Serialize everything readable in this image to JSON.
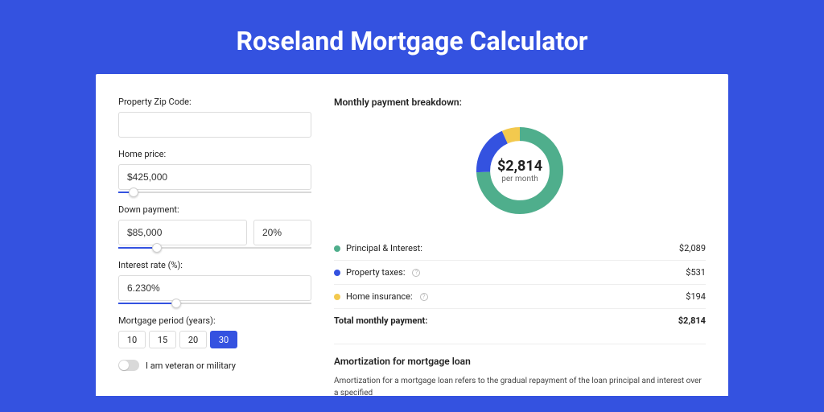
{
  "header": {
    "title": "Roseland Mortgage Calculator"
  },
  "form": {
    "zip_label": "Property Zip Code:",
    "zip_value": "",
    "home_price_label": "Home price:",
    "home_price_value": "$425,000",
    "home_price_slider_pct": 8,
    "down_payment_label": "Down payment:",
    "down_payment_value": "$85,000",
    "down_payment_pct_value": "20%",
    "down_payment_slider_pct": 20,
    "interest_label": "Interest rate (%):",
    "interest_value": "6.230%",
    "interest_slider_pct": 30,
    "period_label": "Mortgage period (years):",
    "period_options": [
      "10",
      "15",
      "20",
      "30"
    ],
    "period_active": "30",
    "veteran_label": "I am veteran or military"
  },
  "breakdown": {
    "title": "Monthly payment breakdown:",
    "center_amount": "$2,814",
    "center_sub": "per month",
    "items": [
      {
        "label": "Principal & Interest:",
        "value": "$2,089",
        "color": "#4fae8c",
        "help": false
      },
      {
        "label": "Property taxes:",
        "value": "$531",
        "color": "#3452e0",
        "help": true
      },
      {
        "label": "Home insurance:",
        "value": "$194",
        "color": "#f3c94e",
        "help": true
      }
    ],
    "total_label": "Total monthly payment:",
    "total_value": "$2,814"
  },
  "amortization": {
    "title": "Amortization for mortgage loan",
    "text": "Amortization for a mortgage loan refers to the gradual repayment of the loan principal and interest over a specified"
  },
  "chart_data": {
    "type": "pie",
    "title": "Monthly payment breakdown",
    "values": [
      2089,
      531,
      194
    ],
    "categories": [
      "Principal & Interest",
      "Property taxes",
      "Home insurance"
    ],
    "colors": [
      "#4fae8c",
      "#3452e0",
      "#f3c94e"
    ],
    "total": 2814
  }
}
